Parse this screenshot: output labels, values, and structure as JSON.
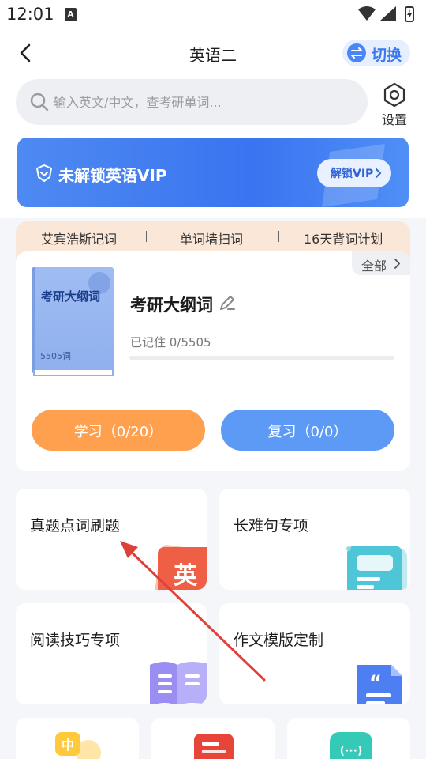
{
  "status": {
    "time": "12:01",
    "sim": "A"
  },
  "header": {
    "title": "英语二",
    "switch_label": "切换"
  },
  "search": {
    "placeholder": "输入英文/中文，查考研单词..."
  },
  "settings": {
    "label": "设置"
  },
  "vip": {
    "text": "未解锁英语VIP",
    "unlock_label": "解锁VIP"
  },
  "plans": [
    "艾宾浩斯记词",
    "单词墙扫词",
    "16天背词计划"
  ],
  "book": {
    "all_label": "全部",
    "cover_title": "考研大纲词",
    "cover_count": "5505词",
    "name": "考研大纲词",
    "remember": "已记住  0/5505",
    "progress_fraction": 0,
    "learn_label": "学习（0/20）",
    "review_label": "复习（0/0）"
  },
  "features": [
    {
      "label": "真题点词刷题",
      "icon": "ying-character-icon",
      "icon_text": "英"
    },
    {
      "label": "长难句专项",
      "icon": "sentence-card-icon"
    },
    {
      "label": "阅读技巧专项",
      "icon": "open-book-icon"
    },
    {
      "label": "作文模版定制",
      "icon": "quote-document-icon"
    }
  ],
  "bottom_icons": [
    {
      "icon": "zhong-chat-icon",
      "icon_text": "中"
    },
    {
      "icon": "red-document-icon"
    },
    {
      "icon": "ellipsis-chat-icon",
      "icon_text": "(···)"
    }
  ],
  "colors": {
    "accent": "#4a86f5",
    "learn": "#ffa04e",
    "review": "#5d9af5",
    "vip": "#3a74f0",
    "plans_bg": "#fbe7d7"
  }
}
